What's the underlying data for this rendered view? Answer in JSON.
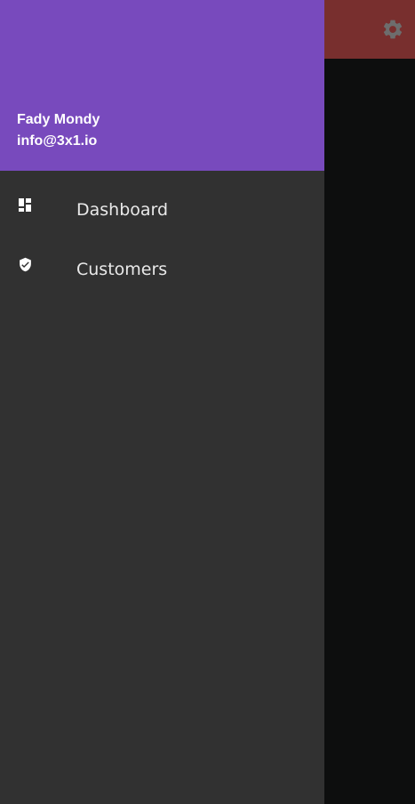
{
  "app_bar": {
    "settings_icon": "gear-icon"
  },
  "drawer": {
    "header": {
      "account_name": "Fady Mondy",
      "account_email": "info@3x1.io"
    },
    "items": [
      {
        "label": "Dashboard",
        "icon": "dashboard-icon"
      },
      {
        "label": "Customers",
        "icon": "shield-check-icon"
      }
    ]
  },
  "colors": {
    "drawer_header": "#784abd",
    "drawer_background": "#313131",
    "app_bar_dimmed": "#782f2e",
    "app_body_dimmed": "#0d0e0e",
    "drawer_text": "#e9e9e9",
    "settings_icon_dimmed": "#6d6d6d"
  }
}
